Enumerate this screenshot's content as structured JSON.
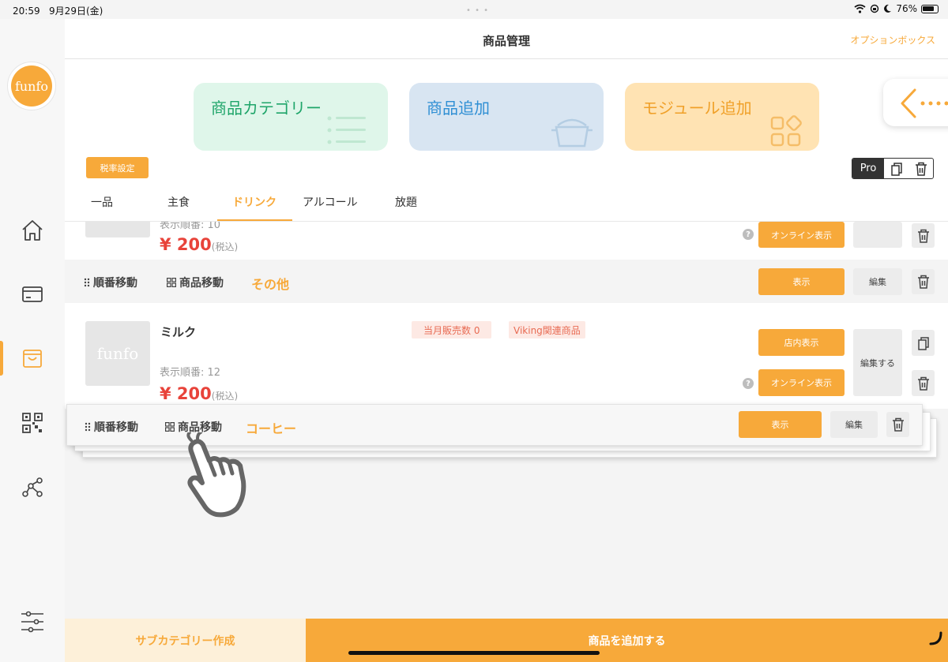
{
  "status": {
    "time": "20:59",
    "date": "9月29日(金)",
    "battery": "76%"
  },
  "header": {
    "title": "商品管理",
    "option_box": "オプションボックス"
  },
  "sidebar": {
    "logo": "funfo",
    "active_index": 2
  },
  "quick_cards": [
    {
      "label": "商品カテゴリー",
      "color": "#1fa56a",
      "bg": "#dff6ea"
    },
    {
      "label": "商品追加",
      "color": "#2f8fd4",
      "bg": "#d8e5f2"
    },
    {
      "label": "モジュール追加",
      "color": "#f0a028",
      "bg": "#ffe3b3"
    }
  ],
  "tax_setting": "税率設定",
  "pro_label": "Pro",
  "tabs": [
    "一品",
    "主食",
    "ドリンク",
    "アルコール",
    "放題"
  ],
  "active_tab": 2,
  "partial_item": {
    "order_label": "表示順番: 10",
    "price": "¥ 200",
    "tax": "(税込)",
    "online_btn": "オンライン表示"
  },
  "subcategory": {
    "reorder": "順番移動",
    "move": "商品移動",
    "name": "その他",
    "show_btn": "表示",
    "edit_btn": "編集"
  },
  "item": {
    "name": "ミルク",
    "thumb_logo": "funfo",
    "tags": [
      "当月販売数 0",
      "Viking関連商品"
    ],
    "order_label": "表示順番: 12",
    "price": "¥ 200",
    "tax": "(税込)",
    "store_btn": "店内表示",
    "online_btn": "オンライン表示",
    "edit_btn": "編集する"
  },
  "dragged_subcategory": {
    "reorder": "順番移動",
    "move": "商品移動",
    "name": "コーヒー",
    "show_btn": "表示",
    "edit_btn": "編集"
  },
  "footer": {
    "create_sub": "サブカテゴリー作成",
    "add_item": "商品を追加する"
  }
}
